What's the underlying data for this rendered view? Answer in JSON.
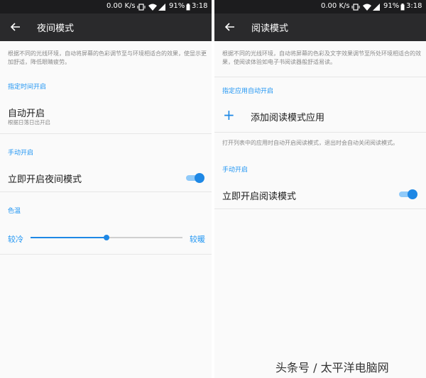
{
  "status_bar": {
    "speed": "0.00 K/s",
    "battery": "91%",
    "time": "3:18"
  },
  "night_mode": {
    "title": "夜间模式",
    "description": "根据不同的光线环境，自动将屏幕的色彩调节至与环境相适合的效果，使显示更加舒适，降低眼睛疲劳。",
    "section_schedule": "指定时间开启",
    "auto_on_title": "自动开启",
    "auto_on_subtitle": "根据日落日出开启",
    "section_manual": "手动开启",
    "instant_on_label": "立即开启夜间模式",
    "instant_on_enabled": true,
    "section_color_temp": "色温",
    "color_temp_min_label": "较冷",
    "color_temp_max_label": "较暖",
    "color_temp_level": 0.5
  },
  "reading_mode": {
    "title": "阅读模式",
    "description": "根据不同的光线环境，自动将屏幕的色彩及文字效果调节至所处环境相适合的效果，使阅读体验如电子书阅读器般舒适易读。",
    "section_apps": "指定应用自动开启",
    "add_app_label": "添加阅读模式应用",
    "apps_note": "打开列表中的应用时自动开启阅读模式，退出时会自动关闭阅读模式。",
    "section_manual": "手动开启",
    "instant_on_label": "立即开启阅读模式",
    "instant_on_enabled": true
  },
  "watermark": "头条号 / 太平洋电脑网",
  "colors": {
    "accent": "#1e88e5",
    "toolbar": "#2a2a2c",
    "statusbar": "#1c1c1e"
  },
  "icons": {
    "back": "arrow-left-icon",
    "add": "plus-icon",
    "wifi": "wifi-icon",
    "signal": "signal-icon",
    "battery": "battery-icon",
    "vibrate": "vibrate-icon"
  }
}
